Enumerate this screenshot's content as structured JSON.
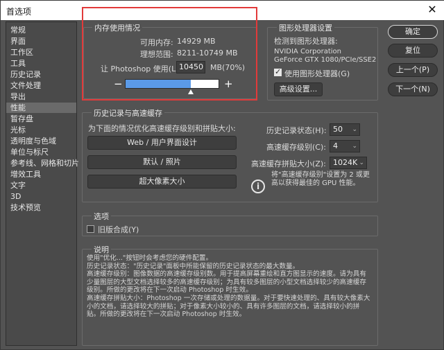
{
  "window": {
    "title": "首选项",
    "close_glyph": "✕"
  },
  "sidebar": {
    "items": [
      {
        "label": "常规"
      },
      {
        "label": "界面"
      },
      {
        "label": "工作区"
      },
      {
        "label": "工具"
      },
      {
        "label": "历史记录"
      },
      {
        "label": "文件处理"
      },
      {
        "label": "导出"
      },
      {
        "label": "性能",
        "active": true
      },
      {
        "label": "暂存盘"
      },
      {
        "label": "光标"
      },
      {
        "label": "透明度与色域"
      },
      {
        "label": "单位与标尺"
      },
      {
        "label": "参考线、网格和切片"
      },
      {
        "label": "增效工具"
      },
      {
        "label": "文字"
      },
      {
        "label": "3D"
      },
      {
        "label": "技术预览"
      }
    ]
  },
  "memory": {
    "group_title": "内存使用情况",
    "available_label": "可用内存:",
    "available_value": "14929 MB",
    "ideal_label": "理想范围:",
    "ideal_value": "8211-10749 MB",
    "let_label": "让 Photoshop 使用(L):",
    "let_value": "10450",
    "let_suffix": "MB(70%)",
    "slider_fraction": 0.7,
    "minus": "−",
    "plus": "+"
  },
  "gpu": {
    "group_title": "图形处理器设置",
    "detected_label": "检测到图形处理器:",
    "line1": "NVIDIA Corporation",
    "line2": "GeForce GTX 1080/PCIe/SSE2",
    "use_gpu_label": "使用图形处理器(G)",
    "use_gpu_checked": true,
    "advanced_button": "高级设置..."
  },
  "buttons": {
    "ok": "确定",
    "reset": "复位",
    "prev": "上一个(P)",
    "next": "下一个(N)"
  },
  "history": {
    "group_title": "历史记录与高速缓存",
    "optimize_label": "为下面的情况优化高速缓存级别和拼贴大小:",
    "web_button": "Web / 用户界面设计",
    "default_button": "默认 / 照片",
    "huge_button": "超大像素大小",
    "states_label": "历史记录状态(H):",
    "states_value": "50",
    "cache_levels_label": "高速缓存级别(C):",
    "cache_levels_value": "4",
    "tile_size_label": "高速缓存拼贴大小(Z):",
    "tile_size_value": "1024K",
    "info_text": "将\"高速缓存级别\"设置为 2 或更高以获得最佳的 GPU 性能。",
    "info_icon_glyph": "i"
  },
  "options": {
    "group_title": "选项",
    "legacy_compositing_label": "旧版合成(Y)",
    "legacy_checked": false
  },
  "description": {
    "group_title": "说明",
    "lines": [
      "使用\"优化...\"按钮时会考虑您的硬件配置。",
      "历史记录状态：\"历史记录\"面板中所能保留的历史记录状态的最大数量。",
      "高速缓存级别：图像数据的高速缓存级别数。用于提高屏幕重绘和直方图显示的速度。请为具有少量图层的大型文档选择较多的高速缓存级别；为具有较多图层的小型文档选择较少的高速缓存级别。所做的更改将在下一次启动 Photoshop 时生效。",
      "高速缓存拼贴大小：Photoshop 一次存储或处理的数据量。对于要快速处理的、具有较大像素大小的文档，请选择较大的拼贴；对于像素大小较小的、具有许多图层的文档，请选择较小的拼贴。所做的更改将在下一次启动 Photoshop 时生效。"
    ]
  },
  "colors": {
    "highlight_box": "#e23a3a",
    "slider_fill": "#5b9ae8"
  }
}
